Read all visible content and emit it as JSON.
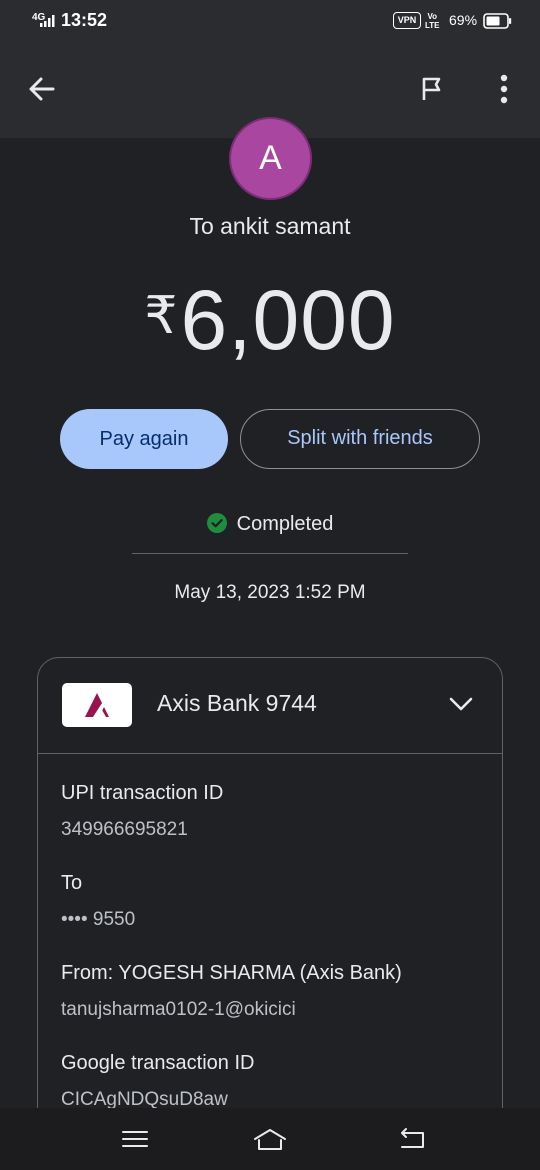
{
  "status_bar": {
    "network": "4G",
    "time": "13:52",
    "vpn": "VPN",
    "volte_top": "Vo",
    "volte_bottom": "LTE",
    "battery": "69%"
  },
  "app_bar": {
    "back_icon": "arrow-back-icon",
    "flag_icon": "flag-icon",
    "more_icon": "more-vert-icon"
  },
  "payment": {
    "avatar_letter": "A",
    "recipient": "To ankit samant",
    "currency_symbol": "₹",
    "amount": "6,000",
    "pay_again_label": "Pay again",
    "split_label": "Split with friends",
    "status": "Completed",
    "datetime": "May 13, 2023 1:52 PM"
  },
  "details": {
    "bank_name": "Axis Bank 9744",
    "upi_label": "UPI transaction ID",
    "upi_value": "349966695821",
    "to_label": "To",
    "to_value": "•••• 9550",
    "from_label": "From: YOGESH SHARMA (Axis Bank)",
    "from_value": "tanujsharma0102-1@okicici",
    "google_label": "Google transaction ID",
    "google_value": "CICAgNDQsuD8aw"
  },
  "colors": {
    "background": "#202124",
    "avatar": "#a846a0",
    "primary_button": "#a8c7fa",
    "success": "#1e8e3e",
    "axis_brand": "#97144d"
  }
}
